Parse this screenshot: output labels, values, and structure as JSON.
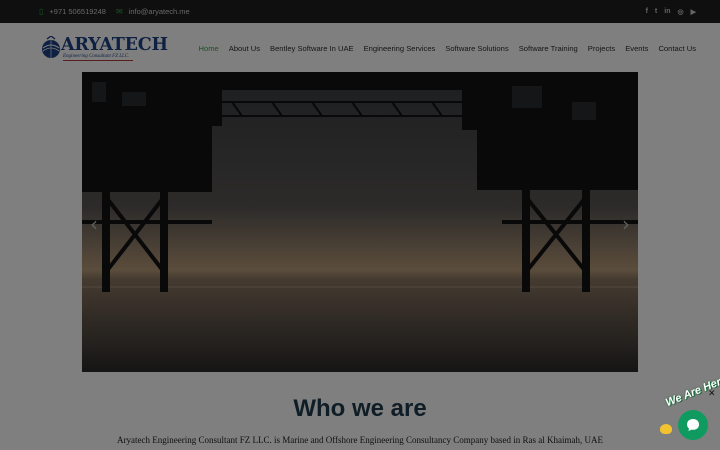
{
  "topbar": {
    "phone": "+971 506519248",
    "email": "info@aryatech.me",
    "social": [
      {
        "icon": "facebook-icon",
        "glyph": "f"
      },
      {
        "icon": "twitter-icon",
        "glyph": "t"
      },
      {
        "icon": "linkedin-icon",
        "glyph": "in"
      },
      {
        "icon": "instagram-icon",
        "glyph": "◎"
      },
      {
        "icon": "youtube-icon",
        "glyph": "▶"
      }
    ]
  },
  "logo": {
    "name": "ARYATECH",
    "tagline": "Engineering Consultant FZ LLC."
  },
  "nav": {
    "items": [
      {
        "label": "Home",
        "active": true
      },
      {
        "label": "About Us"
      },
      {
        "label": "Bentley Software In UAE"
      },
      {
        "label": "Engineering Services"
      },
      {
        "label": "Software Solutions"
      },
      {
        "label": "Software Training"
      },
      {
        "label": "Projects"
      },
      {
        "label": "Events"
      },
      {
        "label": "Contact Us"
      }
    ]
  },
  "slider": {
    "prev_glyph": "‹",
    "next_glyph": "›"
  },
  "about": {
    "heading": "Who we are",
    "paragraph": "Aryatech Engineering Consultant FZ LLC. is Marine and Offshore Engineering Consultancy Company based in Ras al Khaimah, UAE"
  },
  "chat": {
    "badge": "We Are Here!",
    "close_glyph": "✕"
  },
  "colors": {
    "accent": "#3aa54b",
    "brand": "#1e4286",
    "heading": "#1f3a4c",
    "chat": "#0f9b5f"
  }
}
